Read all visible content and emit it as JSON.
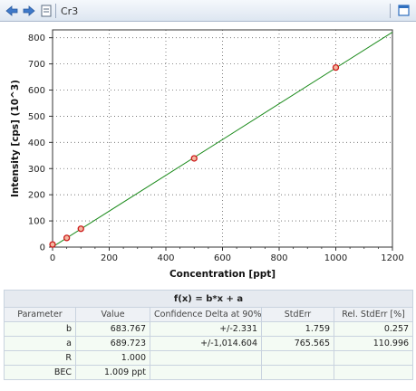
{
  "toolbar": {
    "title": "Cr3",
    "icons": [
      "arrow-left-icon",
      "arrow-right-icon",
      "document-icon",
      "window-restore-icon"
    ]
  },
  "colors": {
    "line": "#1a8a1a",
    "point_fill": "#f3b7a0",
    "point_stroke": "#cc1a1a",
    "grid": "#666666"
  },
  "chart_data": {
    "type": "scatter",
    "xlabel": "Concentration [ppt]",
    "ylabel": "Intensity [cps] (10^3)",
    "xlim": [
      0,
      1200
    ],
    "ylim": [
      0,
      830
    ],
    "x_ticks": [
      0,
      200,
      400,
      600,
      800,
      1000,
      1200
    ],
    "y_ticks": [
      0,
      100,
      200,
      300,
      400,
      500,
      600,
      700,
      800
    ],
    "grid": true,
    "series": [
      {
        "points": [
          [
            0,
            10
          ],
          [
            50,
            35
          ],
          [
            100,
            70
          ],
          [
            500,
            339
          ],
          [
            1000,
            686
          ]
        ]
      }
    ],
    "fit_line": {
      "slope": 0.683767,
      "intercept": 0.689723,
      "x_range": [
        0,
        1200
      ]
    }
  },
  "table": {
    "formula": "f(x) = b*x + a",
    "headers": [
      "Parameter",
      "Value",
      "Confidence Delta at 90%",
      "StdErr",
      "Rel. StdErr [%]"
    ],
    "rows": [
      [
        "b",
        "683.767",
        "+/-2.331",
        "1.759",
        "0.257"
      ],
      [
        "a",
        "689.723",
        "+/-1,014.604",
        "765.565",
        "110.996"
      ],
      [
        "R",
        "1.000",
        "",
        "",
        ""
      ],
      [
        "BEC",
        "1.009 ppt",
        "",
        "",
        ""
      ]
    ]
  }
}
